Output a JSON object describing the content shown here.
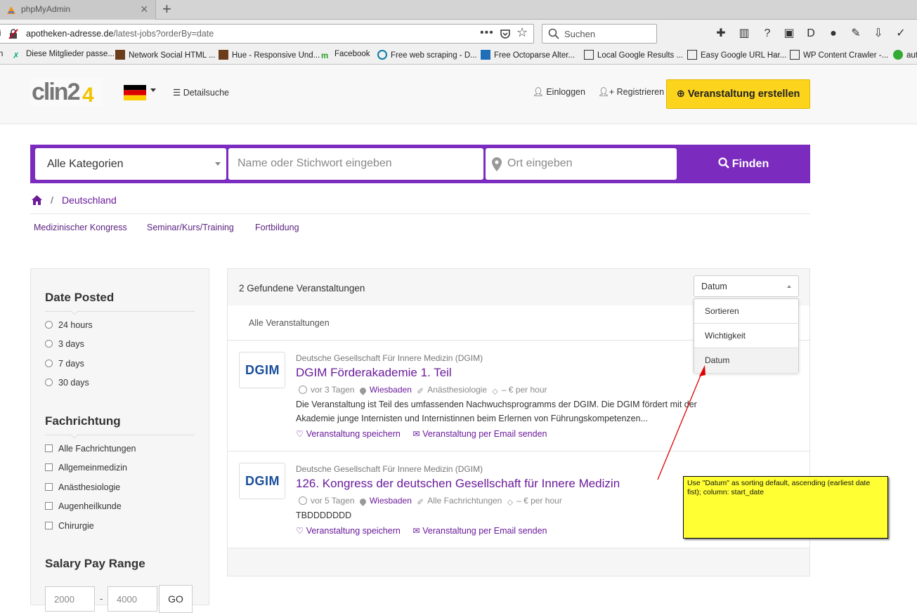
{
  "browser": {
    "tab_title": "phpMyAdmin",
    "url_host": "apotheken-adresse.de",
    "url_path": "/latest-jobs?orderBy=date",
    "search_placeholder": "Suchen",
    "url_more": "•••",
    "bookmarks": [
      {
        "label": "n"
      },
      {
        "label": "Diese Mitglieder passe..."
      },
      {
        "label": "Network Social HTML ..."
      },
      {
        "label": "Hue - Responsive Und..."
      },
      {
        "label": "Facebook"
      },
      {
        "label": "Free web scraping - D..."
      },
      {
        "label": "Free Octoparse Alter..."
      },
      {
        "label": "Local Google Results ..."
      },
      {
        "label": "Easy Google URL Har..."
      },
      {
        "label": "WP Content Crawler -..."
      },
      {
        "label": "aut"
      }
    ]
  },
  "header": {
    "logo_text": "clin24",
    "detail_search": "Detailsuche",
    "login": "Einloggen",
    "register": "Registrieren",
    "create_event": "Veranstaltung erstellen"
  },
  "search": {
    "category": "Alle Kategorien",
    "keyword_placeholder": "Name oder Stichwort eingeben",
    "location_placeholder": "Ort eingeben",
    "find": "Finden"
  },
  "breadcrumb": {
    "separator": "/",
    "country": "Deutschland"
  },
  "categories": [
    "Medizinischer Kongress",
    "Seminar/Kurs/Training",
    "Fortbildung"
  ],
  "sidebar": {
    "date_title": "Date Posted",
    "date_options": [
      "24 hours",
      "3 days",
      "7 days",
      "30 days"
    ],
    "specialty_title": "Fachrichtung",
    "specialty_options": [
      "Alle Fachrichtungen",
      "Allgemeinmedizin",
      "Anästhesiologie",
      "Augenheilkunde",
      "Chirurgie"
    ],
    "salary_title": "Salary Pay Range",
    "salary_min": "2000",
    "salary_dash": "-",
    "salary_max": "4000",
    "go": "GO"
  },
  "results": {
    "count_text": "2 Gefundene Veranstaltungen",
    "tab_all": "Alle Veranstaltungen",
    "sort": {
      "value": "Datum",
      "options": [
        "Sortieren",
        "Wichtigkeit",
        "Datum"
      ],
      "selected": "Datum"
    },
    "items": [
      {
        "logo": "DGIM",
        "org": "Deutsche Gesellschaft Für Innere Medizin (DGIM)",
        "title": "DGIM Förderakademie 1. Teil",
        "posted": "vor 3 Tagen",
        "location": "Wiesbaden",
        "specialty": "Anästhesiologie",
        "rate": "– € per hour",
        "description": "Die Veranstaltung ist Teil des umfassenden Nachwuchsprogramms der DGIM. Die DGIM fördert mit der Akademie junge Internisten und Internistinnen beim Erlernen von Führungskompetenzen...",
        "save": "Veranstaltung speichern",
        "email": "Veranstaltung per Email senden"
      },
      {
        "logo": "DGIM",
        "org": "Deutsche Gesellschaft Für Innere Medizin (DGIM)",
        "title": "126. Kongress der deutschen Gesellschaft für Innere Medizin",
        "posted": "vor 5 Tagen",
        "location": "Wiesbaden",
        "specialty": "Alle Fachrichtungen",
        "rate": "– € per hour",
        "description": "TBDDDDDDD",
        "save": "Veranstaltung speichern",
        "email": "Veranstaltung per Email senden"
      }
    ]
  },
  "annotation": {
    "text": "Use \"Datum\" as sorting default, ascending (earliest date fist); column: start_date"
  },
  "colors": {
    "brand_purple": "#7b2cbf",
    "link_purple": "#6a1b9a",
    "create_button": "#fcd31d",
    "note_yellow": "#ffff33",
    "arrow_red": "#e00000"
  }
}
